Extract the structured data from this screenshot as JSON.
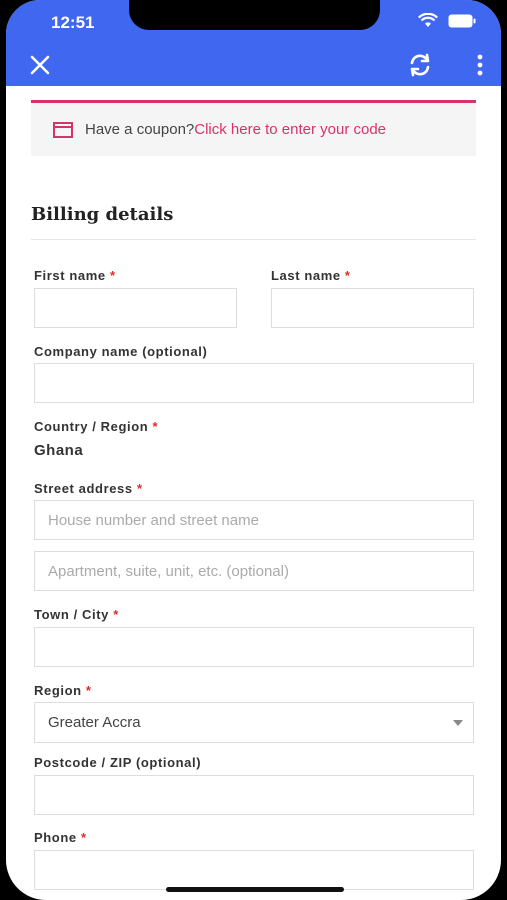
{
  "status_bar": {
    "time": "12:51"
  },
  "app_bar": {
    "close_icon": "close-icon",
    "refresh_icon": "refresh-icon",
    "more_icon": "more-vert-icon",
    "color": "#3f67ef"
  },
  "coupon": {
    "text": "Have a coupon?",
    "link": "Click here to enter your code",
    "accent": "#d6336c"
  },
  "billing": {
    "heading": "Billing details",
    "first_name": {
      "label": "First name",
      "required": "*",
      "value": ""
    },
    "last_name": {
      "label": "Last name",
      "required": "*",
      "value": ""
    },
    "company": {
      "label": "Company name (optional)",
      "value": ""
    },
    "country": {
      "label": "Country / Region",
      "required": "*",
      "value": "Ghana"
    },
    "street": {
      "label": "Street address",
      "required": "*",
      "placeholder1": "House number and street name",
      "placeholder2": "Apartment, suite, unit, etc. (optional)"
    },
    "town": {
      "label": "Town / City",
      "required": "*",
      "value": ""
    },
    "region": {
      "label": "Region",
      "required": "*",
      "value": "Greater Accra"
    },
    "postcode": {
      "label": "Postcode / ZIP (optional)",
      "value": ""
    },
    "phone": {
      "label": "Phone",
      "required": "*",
      "value": ""
    }
  }
}
